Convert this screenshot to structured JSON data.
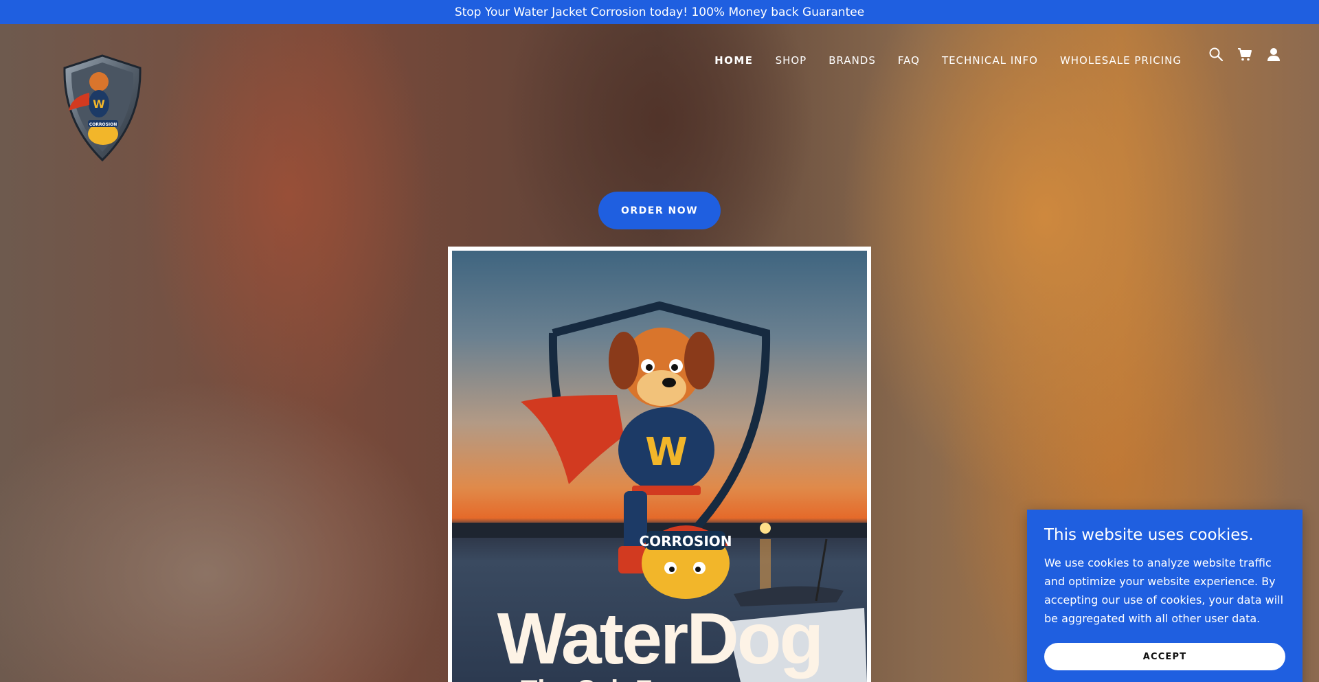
{
  "announcement": "Stop Your Water Jacket Corrosion today! 100% Money back Guarantee",
  "logo": {
    "badge_letter": "W",
    "badge_text": "CORROSION"
  },
  "nav": {
    "items": [
      "HOME",
      "SHOP",
      "BRANDS",
      "FAQ",
      "TECHNICAL INFO",
      "WHOLESALE PRICING"
    ],
    "active": "HOME"
  },
  "icons": [
    "search-icon",
    "cart-icon",
    "account-icon"
  ],
  "hero": {
    "cta": "ORDER NOW",
    "image": {
      "title": "WaterDog",
      "subtitle": "The Sch Fo",
      "mascot_letter": "W",
      "mascot_label": "CORROSION"
    }
  },
  "cookie": {
    "title": "This website uses cookies.",
    "body": "We use cookies to analyze website traffic and optimize your website experience. By accepting our use of cookies, your data will be aggregated with all other user data.",
    "accept": "ACCEPT"
  },
  "colors": {
    "brand_blue": "#1f5fe0",
    "text_light": "#ffffff"
  }
}
